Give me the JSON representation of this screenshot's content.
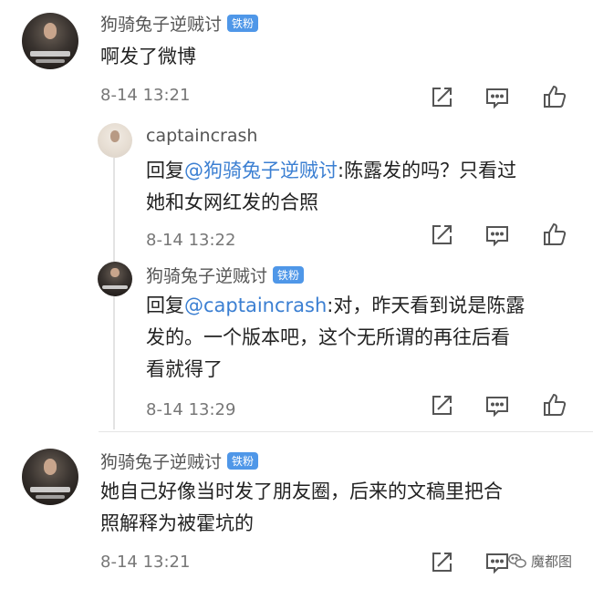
{
  "comments": [
    {
      "username": "狗骑兔子逆贼讨",
      "badge": "铁粉",
      "text": "啊发了微博",
      "time": "8-14 13:21"
    },
    {
      "username": "狗骑兔子逆贼讨",
      "badge": "铁粉",
      "text_line1": "她自己好像当时发了朋友圈，后来的文稿里把合",
      "text_line2": "照解释为被霍坑的",
      "time": "8-14 13:21"
    }
  ],
  "replies": [
    {
      "username": "captaincrash",
      "reply_prefix": "回复",
      "mention": "@狗骑兔子逆贼讨",
      "text_line1_rest": ":陈露发的吗？只看过",
      "text_line2": "她和女网红发的合照",
      "time": "8-14 13:22"
    },
    {
      "username": "狗骑兔子逆贼讨",
      "badge": "铁粉",
      "reply_prefix": "回复",
      "mention": "@captaincrash",
      "text_line1_rest": ":对，昨天看到说是陈露",
      "text_line2": "发的。一个版本吧，这个无所谓的再往后看",
      "text_line3": "看就得了",
      "time": "8-14 13:29"
    }
  ],
  "watermark": "魔都图",
  "icons": [
    "share-icon",
    "comment-icon",
    "like-icon",
    "wechat-icon"
  ],
  "colors": {
    "badge": "#4f97e8",
    "mention": "#3b7fd2",
    "text": "#222222",
    "meta": "#777777"
  }
}
